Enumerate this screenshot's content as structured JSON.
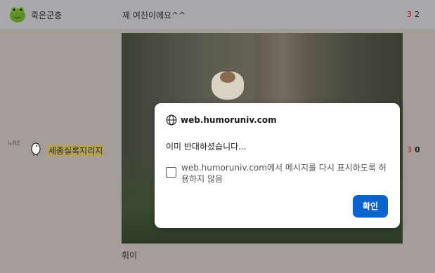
{
  "post": {
    "author": "죽은군충",
    "title": "제 여친이에요^^",
    "count_red": "3",
    "count_dark": "2"
  },
  "reply": {
    "re_label": "RE",
    "author": "세종실록지리지",
    "count_red": "3",
    "count_dark": "0",
    "caption": "훠이"
  },
  "dialog": {
    "host": "web.humoruniv.com",
    "message": "이미 반대하셨습니다...",
    "checkbox_label": "web.humoruniv.com에서 메시지를 다시 표시하도록 허용하지 않음",
    "checkbox_checked": false,
    "ok_label": "확인",
    "ok_color": "#0b63ce"
  },
  "colors": {
    "red_count": "#b0151a",
    "highlight": "#b3a35a"
  }
}
